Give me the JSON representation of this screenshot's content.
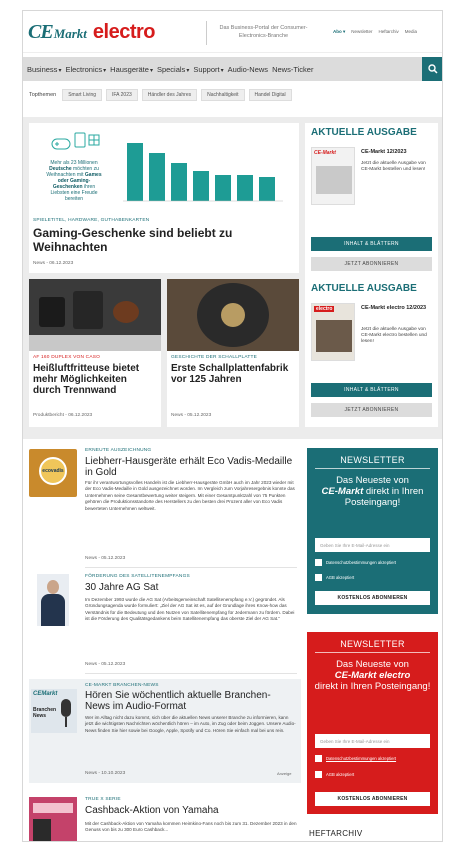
{
  "header": {
    "logo_ce": "CE",
    "logo_markt": "Markt",
    "logo_electro": "electro",
    "tagline": "Das Business-Portal der Consumer-Electronics-Branche",
    "toplinks": [
      "Abo ▾",
      "Newsletter",
      "Heftarchiv",
      "Media"
    ]
  },
  "nav": {
    "items": [
      {
        "label": "Business",
        "chevron": true
      },
      {
        "label": "Electronics",
        "chevron": true
      },
      {
        "label": "Hausgeräte",
        "chevron": true
      },
      {
        "label": "Specials",
        "chevron": true
      },
      {
        "label": "Support",
        "chevron": true
      },
      {
        "label": "Audio-News",
        "chevron": false
      },
      {
        "label": "News-Ticker",
        "chevron": false
      }
    ],
    "search_icon": "search-icon"
  },
  "topics": {
    "label": "Topthemen",
    "chips": [
      "Smart Living",
      "IFA 2023",
      "Händler des Jahres",
      "Nachhaltigkeit",
      "Handel Digital"
    ]
  },
  "hero": {
    "info_text_line1": "Mehr als 23 Millionen",
    "info_text_bold1": "Deutsche",
    "info_text_line2": "möchten zu Weihnachten mit",
    "info_text_bold2": "Games oder Gaming-Geschenken",
    "info_text_line3": "ihren Liebsten eine Freude bereiten",
    "category": "SPIELETITEL, HARDWARE, GUTHABENKARTEN",
    "title": "Gaming-Geschenke sind beliebt zu Weihnachten",
    "meta": "News - 06.12.2023"
  },
  "issue1": {
    "heading": "AKTUELLE AUSGABE",
    "title": "CE-Markt 12/2023",
    "desc": "Jetzt die aktuelle Ausgabe von CE-Markt bestellen und lesen!",
    "btn_read": "INHALT & BLÄTTERN",
    "btn_sub": "JETZT ABONNIEREN"
  },
  "issue2": {
    "heading": "AKTUELLE AUSGABE",
    "title": "CE-Markt electro 12/2023",
    "desc": "Jetzt die aktuelle Ausgabe von CE-Markt electro bestellen und lesen!",
    "btn_read": "INHALT & BLÄTTERN",
    "btn_sub": "JETZT ABONNIEREN"
  },
  "mid": [
    {
      "category": "AF 160 DUPLEX VON CASO",
      "title": "Heißluftfritteuse bietet mehr Möglichkeiten durch Trennwand",
      "meta": "Produktbericht - 06.12.2023"
    },
    {
      "category": "GESCHICHTE DER SCHALLPLATTE",
      "title": "Erste Schallplattenfabrik vor 125 Jahren",
      "meta": "News - 05.12.2023"
    }
  ],
  "list": [
    {
      "category": "ERNEUTE AUSZEICHNUNG",
      "title": "Liebherr-Hausgeräte erhält Eco Vadis-Medaille in Gold",
      "body": "Für ihr verantwortungsvolles Handeln ist die Liebherr-Hausgeräte GmbH auch im Jahr 2023 wieder mit der Eco Vadis-Medaille in Gold ausgezeichnet worden. Im Vergleich zum Vorjahresergebnis konnte das Unternehmen seine Gesamtbewertung weiter steigern. Mit einer Gesamtpunktzahl von 75 Punkten gehören die Produktionsstandorte des Herstellers zu den besten drei Prozent aller von Eco Vadis bewerteten Unternehmen weltweit.",
      "meta": "News - 05.12.2023",
      "thumb_text": "ecovadis"
    },
    {
      "category": "FÖRDERUNG DES SATELLITENEMPFANGS",
      "title": "30 Jahre AG Sat",
      "body": "Im Dezember 1993 wurde die AG Sat (Arbeitsgemeinschaft Satellitenempfang e.V.) gegründet. Als Gründungsagenda wurde formuliert: „Ziel der AG Sat ist es, auf der Grundlage ihres Know-how das Verständnis für die Bedeutung und den Nutzen von Satellitenempfang für Jedermann zu fördern. Dabei ist die Förderung des Qualitätsgedankens beim Satellitenempfang das oberste Ziel der AG Sat.“",
      "meta": "News - 05.12.2023"
    },
    {
      "category": "CE-MARKT BRANCHEN-NEWS",
      "title": "Hören Sie wöchentlich aktuelle Branchen-News im Audio-Format",
      "body": "Wer im Alltag nicht dazu kommt, sich über die aktuellen News unserer Branche zu informieren, kann jetzt die wichtigsten Nachrichten wöchentlich hören – im Auto, im Zug oder beim Joggen. Unsere Audio-News finden Sie hier sowie bei Google, Apple, Spotify und Co. Hören Sie einfach mal bei uns rein.",
      "meta": "News - 10.10.2023",
      "tag": "Anzeige",
      "thumb_text1": "CEMarkt",
      "thumb_text2": "Branchen News"
    },
    {
      "category": "TRUE X SERIE",
      "title": "Cashback-Aktion von Yamaha",
      "body": "Mit der Cashback-Aktion von Yamaha kommen Heimkino-Fans noch bis zum 31. Dezember 2023 in den Genuss von bis zu 300 Euro Cashback..."
    }
  ],
  "newsletter1": {
    "heading": "NEWSLETTER",
    "intro_pre": "Das Neueste von",
    "intro_brand": "CE-Markt",
    "intro_post": "direkt in Ihren Posteingang!",
    "placeholder": "Geben Sie Ihre E-Mail-Adresse ein",
    "check1": "Datenschutzbestimmungen akzeptiert",
    "check2": "AGB akzeptiert",
    "submit": "KOSTENLOS ABONNIEREN",
    "color": "#1b6e76"
  },
  "newsletter2": {
    "heading": "NEWSLETTER",
    "intro_pre": "Das Neueste von",
    "intro_brand": "CE-Markt electro",
    "intro_post": "direkt in Ihren Posteingang!",
    "placeholder": "Geben Sie Ihre E-Mail-Adresse ein",
    "check1": "Datenschutzbestimmungen akzeptiert",
    "check2": "AGB akzeptiert",
    "submit": "KOSTENLOS ABONNIEREN",
    "color": "#d61c1c"
  },
  "heftarchiv": "HEFTARCHIV"
}
